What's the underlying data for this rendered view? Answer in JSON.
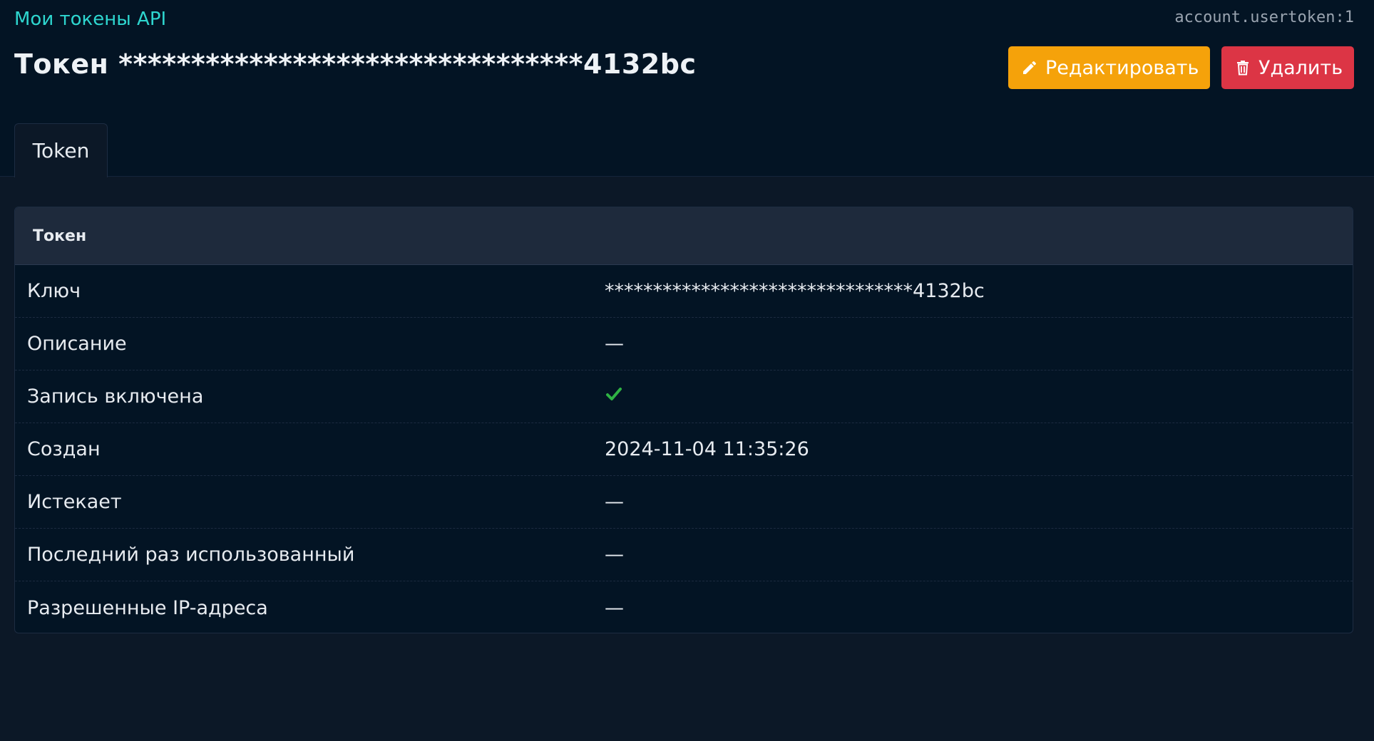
{
  "breadcrumb": "Мои токены API",
  "object_id": "account.usertoken:1",
  "page_title": "Токен ********************************4132bc",
  "actions": {
    "edit_label": "Редактировать",
    "delete_label": "Удалить"
  },
  "tabs": [
    {
      "label": "Token",
      "active": true
    }
  ],
  "card": {
    "title": "Токен",
    "rows": [
      {
        "label": "Ключ",
        "value": "********************************4132bc"
      },
      {
        "label": "Описание",
        "value": "—"
      },
      {
        "label": "Запись включена",
        "value": "",
        "icon": "check-icon"
      },
      {
        "label": "Создан",
        "value": "2024-11-04 11:35:26"
      },
      {
        "label": "Истекает",
        "value": "—"
      },
      {
        "label": "Последний раз использованный",
        "value": "—"
      },
      {
        "label": "Разрешенные IP-адреса",
        "value": "—"
      }
    ]
  },
  "colors": {
    "accent": "#2ed6cf",
    "edit_button": "#f5a20a",
    "delete_button": "#dc3545",
    "check": "#2fb344"
  }
}
